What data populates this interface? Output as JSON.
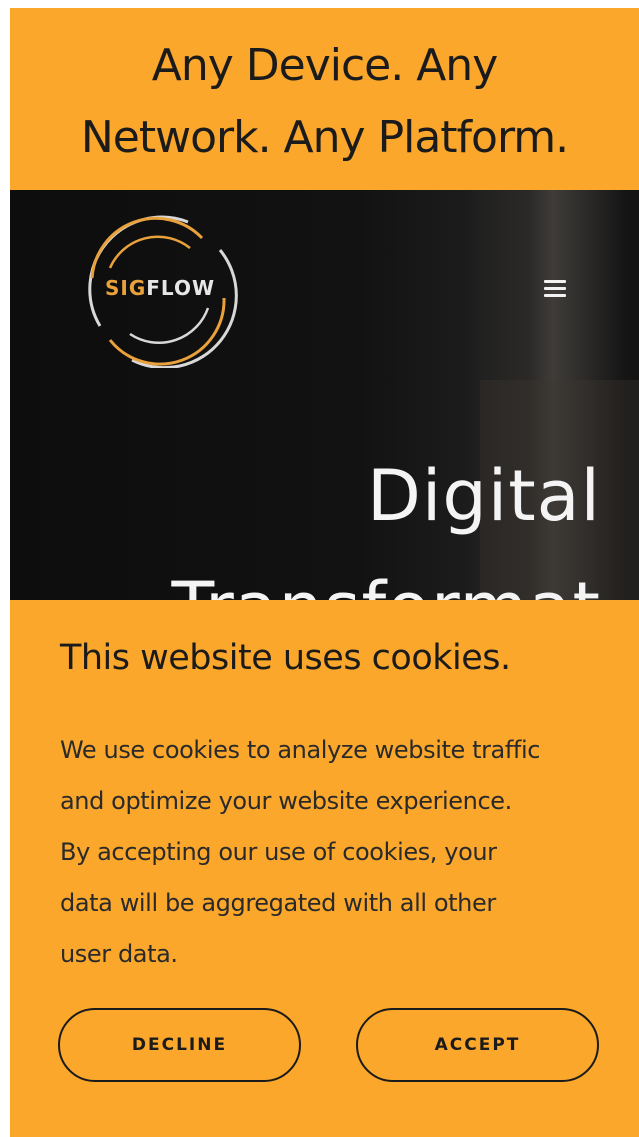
{
  "banner": {
    "line1": "Any Device. Any",
    "line2": "Network. Any Platform."
  },
  "header": {
    "logo_text": "SIGFLOW",
    "menu_icon": "hamburger-menu-icon"
  },
  "hero": {
    "title_line1": "Digital",
    "title_line2": "Transformat"
  },
  "cookie_banner": {
    "title": "This website uses cookies.",
    "body_lines": [
      "We use cookies to analyze website traffic",
      "and optimize your website experience.",
      "By accepting our use of cookies, your",
      "data will be aggregated with all other",
      "user data."
    ],
    "decline_label": "DECLINE",
    "accept_label": "ACCEPT"
  },
  "colors": {
    "accent": "#FBA72B",
    "hero_background": "#111111",
    "text_dark": "#1b1b1b",
    "logo_ring_gold": "#E9A23B",
    "logo_ring_light": "#D8D8D8"
  }
}
